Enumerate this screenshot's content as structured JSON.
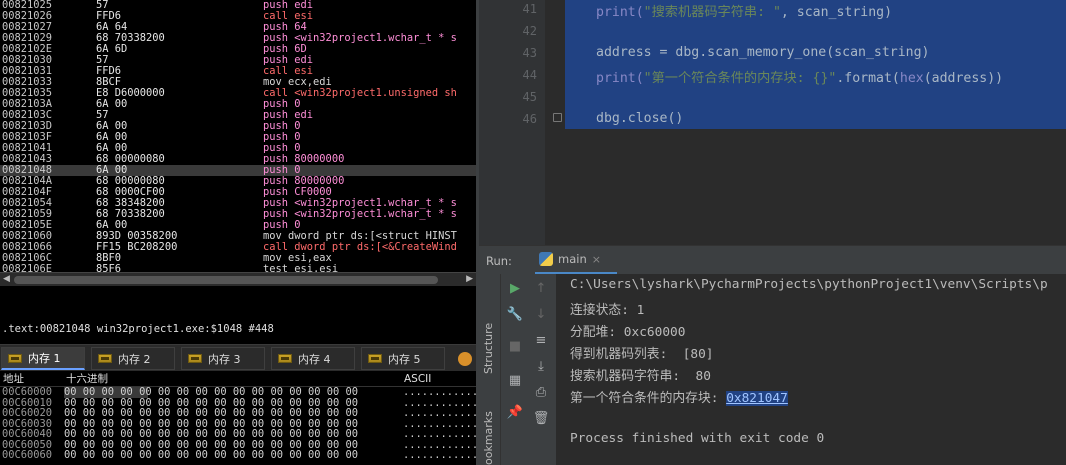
{
  "debugger": {
    "disasm_rows": [
      {
        "addr": "00821025",
        "bytes": "57",
        "instr": "push edi",
        "kind": "push"
      },
      {
        "addr": "00821026",
        "bytes": "FFD6",
        "instr": "call esi",
        "kind": "call"
      },
      {
        "addr": "00821027",
        "bytes": "6A 64",
        "instr": "push 64",
        "kind": "push"
      },
      {
        "addr": "00821029",
        "bytes": "68 70338200",
        "instr": "push <win32project1.wchar_t * s",
        "kind": "arg",
        "ubytes": "70338200"
      },
      {
        "addr": "0082102E",
        "bytes": "6A 6D",
        "instr": "push 6D",
        "kind": "push"
      },
      {
        "addr": "00821030",
        "bytes": "57",
        "instr": "push edi",
        "kind": "push"
      },
      {
        "addr": "00821031",
        "bytes": "FFD6",
        "instr": "call esi",
        "kind": "call"
      },
      {
        "addr": "00821033",
        "bytes": "8BCF",
        "instr": "mov ecx,edi",
        "kind": "mov"
      },
      {
        "addr": "00821035",
        "bytes": "E8 D6000000",
        "instr": "call <win32project1.unsigned sh",
        "kind": "call"
      },
      {
        "addr": "0082103A",
        "bytes": "6A 00",
        "instr": "push 0",
        "kind": "push"
      },
      {
        "addr": "0082103C",
        "bytes": "57",
        "instr": "push edi",
        "kind": "push"
      },
      {
        "addr": "0082103D",
        "bytes": "6A 00",
        "instr": "push 0",
        "kind": "push"
      },
      {
        "addr": "0082103F",
        "bytes": "6A 00",
        "instr": "push 0",
        "kind": "push"
      },
      {
        "addr": "00821041",
        "bytes": "6A 00",
        "instr": "push 0",
        "kind": "push"
      },
      {
        "addr": "00821043",
        "bytes": "68 00000080",
        "instr": "push 80000000",
        "kind": "push"
      },
      {
        "addr": "00821048",
        "bytes": "6A 00",
        "instr": "push 0",
        "kind": "push",
        "selected": true
      },
      {
        "addr": "0082104A",
        "bytes": "68 00000080",
        "instr": "push 80000000",
        "kind": "push"
      },
      {
        "addr": "0082104F",
        "bytes": "68 0000CF00",
        "instr": "push CF0000",
        "kind": "push"
      },
      {
        "addr": "00821054",
        "bytes": "68 38348200",
        "instr": "push <win32project1.wchar_t * s",
        "kind": "arg",
        "ubytes": "38348200"
      },
      {
        "addr": "00821059",
        "bytes": "68 70338200",
        "instr": "push <win32project1.wchar_t * s",
        "kind": "arg",
        "ubytes": "70338200"
      },
      {
        "addr": "0082105E",
        "bytes": "6A 00",
        "instr": "push 0",
        "kind": "push"
      },
      {
        "addr": "00821060",
        "bytes": "893D 00358200",
        "instr": "mov dword ptr ds:[<struct HINST",
        "kind": "mov",
        "ubytes": "00358200"
      },
      {
        "addr": "00821066",
        "bytes": "FF15 BC208200",
        "instr": "call dword ptr ds:[<&CreateWind",
        "kind": "call",
        "ubytes": "BC208200"
      },
      {
        "addr": "0082106C",
        "bytes": "8BF0",
        "instr": "mov esi,eax",
        "kind": "mov"
      },
      {
        "addr": "0082106E",
        "bytes": "85F6",
        "instr": "test esi,esi",
        "kind": "mov"
      }
    ],
    "info_line": ".text:00821048 win32project1.exe:$1048 #448",
    "mem_tabs": [
      {
        "label": "内存 1"
      },
      {
        "label": "内存 2"
      },
      {
        "label": "内存 3"
      },
      {
        "label": "内存 4"
      },
      {
        "label": "内存 5"
      }
    ],
    "dump_header": {
      "addr": "地址",
      "hex": "十六进制",
      "ascii": "ASCII"
    },
    "dump_rows": [
      {
        "addr": "00C60000",
        "hex": "00 00 00 00 00 00 00 00 00 00 00 00 00 00 00 00",
        "ascii": "................"
      },
      {
        "addr": "00C60010",
        "hex": "00 00 00 00 00 00 00 00 00 00 00 00 00 00 00 00",
        "ascii": "................"
      },
      {
        "addr": "00C60020",
        "hex": "00 00 00 00 00 00 00 00 00 00 00 00 00 00 00 00",
        "ascii": "................"
      },
      {
        "addr": "00C60030",
        "hex": "00 00 00 00 00 00 00 00 00 00 00 00 00 00 00 00",
        "ascii": "................"
      },
      {
        "addr": "00C60040",
        "hex": "00 00 00 00 00 00 00 00 00 00 00 00 00 00 00 00",
        "ascii": "................"
      },
      {
        "addr": "00C60050",
        "hex": "00 00 00 00 00 00 00 00 00 00 00 00 00 00 00 00",
        "ascii": "................"
      },
      {
        "addr": "00C60060",
        "hex": "00 00 00 00 00 00 00 00 00 00 00 00 00 00 00 00",
        "ascii": "................"
      }
    ]
  },
  "editor": {
    "lines": [
      {
        "num": "41",
        "parts": [
          {
            "t": "print(",
            "c": "fn"
          },
          {
            "t": "\"搜索机器码字符串: \"",
            "c": "str"
          },
          {
            "t": ", scan_string)",
            "c": ""
          }
        ]
      },
      {
        "num": "42",
        "parts": []
      },
      {
        "num": "43",
        "parts": [
          {
            "t": "address = dbg.scan_memory_one(scan_string)",
            "c": ""
          }
        ]
      },
      {
        "num": "44",
        "parts": [
          {
            "t": "print(",
            "c": "fn"
          },
          {
            "t": "\"第一个符合条件的内存块: {}\"",
            "c": "str"
          },
          {
            "t": ".format(",
            "c": ""
          },
          {
            "t": "hex",
            "c": "fn"
          },
          {
            "t": "(address))",
            "c": ""
          }
        ]
      },
      {
        "num": "45",
        "parts": []
      },
      {
        "num": "46",
        "parts": [
          {
            "t": "dbg.close()",
            "c": ""
          }
        ]
      }
    ]
  },
  "run": {
    "label": "Run:",
    "tab_name": "main",
    "close_glyph": "×",
    "side_labels": {
      "structure": "Structure",
      "bookmarks": "ookmarks"
    },
    "console": [
      "C:\\Users\\lyshark\\PycharmProjects\\pythonProject1\\venv\\Scripts\\p",
      "连接状态: 1",
      "分配堆: 0xc60000",
      "得到机器码列表:  [80]",
      "搜索机器码字符串:  80",
      "第一个符合条件的内存块: ",
      "",
      "Process finished with exit code 0"
    ],
    "highlight_value": "0x821047"
  }
}
